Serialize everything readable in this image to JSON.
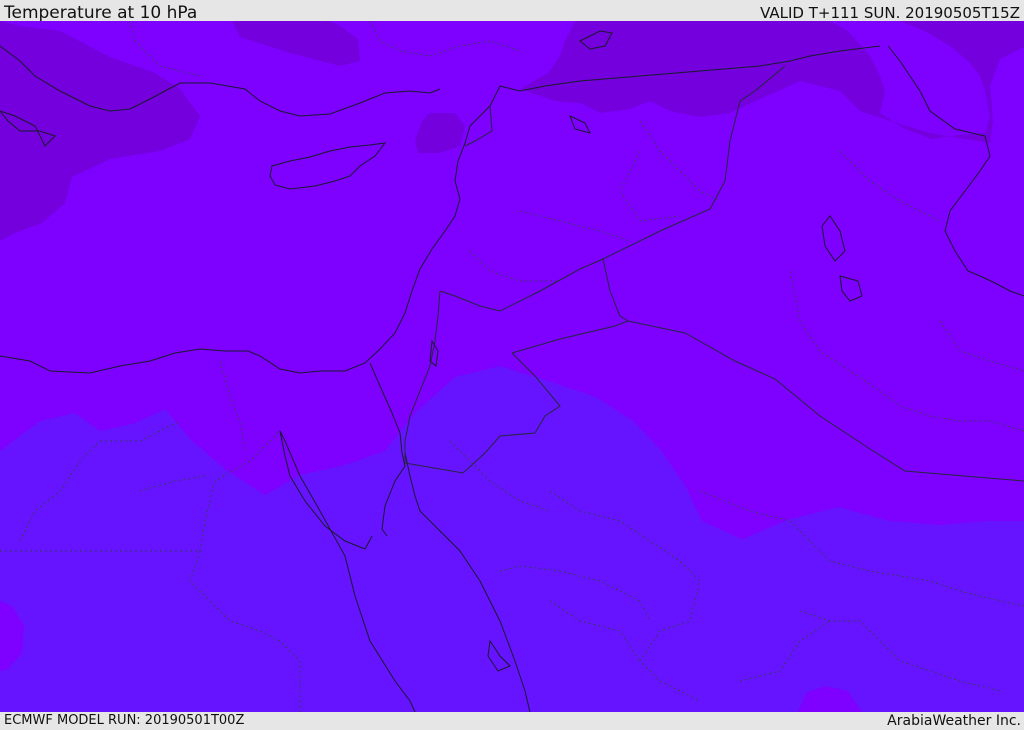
{
  "header": {
    "title": "Temperature at 10 hPa",
    "valid": "VALID T+111 SUN. 20190505T15Z"
  },
  "footer": {
    "model_run": "ECMWF MODEL RUN: 20190501T00Z",
    "credit": "ArabiaWeather Inc."
  },
  "map": {
    "fill_colors": {
      "warm": "#7e00ff",
      "warmer": "#7400dd",
      "cool": "#6614ff"
    },
    "line_colors": {
      "coastline": "#1a1a2e",
      "border": "#262640"
    }
  }
}
